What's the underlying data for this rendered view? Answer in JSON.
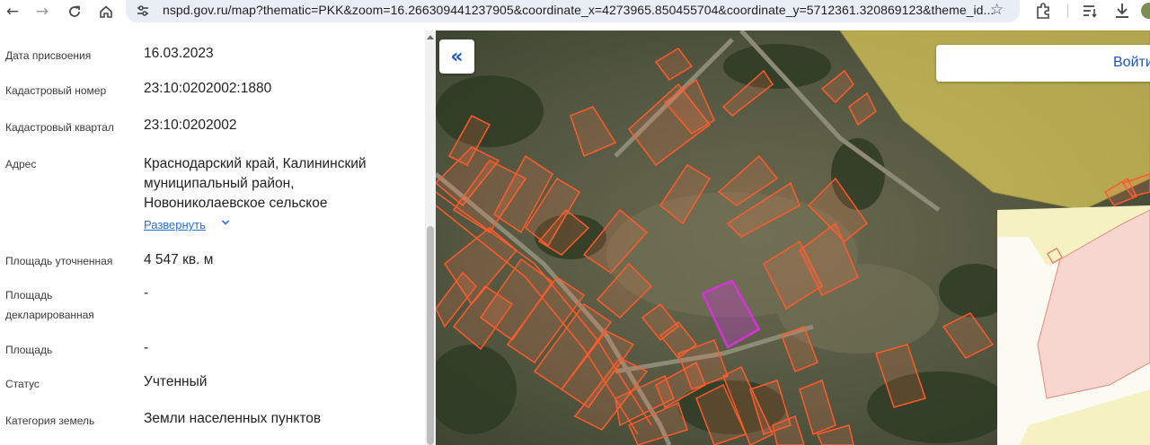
{
  "browser": {
    "url": "nspd.gov.ru/map?thematic=PKK&zoom=16.266309441237905&coordinate_x=4273965.850455704&coordinate_y=5712361.320869123&theme_id...",
    "icons": [
      "back-arrow-icon",
      "forward-arrow-icon",
      "reload-icon",
      "home-icon",
      "site-settings-icon",
      "bookmark-star-icon",
      "extensions-icon",
      "reading-list-icon",
      "download-icon"
    ]
  },
  "panel": {
    "rows": [
      {
        "label": "Дата присвоения",
        "value": "16.03.2023"
      },
      {
        "label": "Кадастровый номер",
        "value": "23:10:0202002:1880"
      },
      {
        "label": "Кадастровый квартал",
        "value": "23:10:0202002"
      },
      {
        "label": "Адрес",
        "value_lines": [
          "Краснодарский край, Калининский",
          "муниципальный район,",
          "Новониколаевское сельское"
        ],
        "expand_label": "Развернуть"
      },
      {
        "label": "Площадь уточненная",
        "value": "4 547 кв. м"
      },
      {
        "label_lines": [
          "Площадь",
          "декларированная"
        ],
        "value": "-"
      },
      {
        "label": "Площадь",
        "value": "-"
      },
      {
        "label": "Статус",
        "value": "Учтенный"
      },
      {
        "label": "Категория земель",
        "value": "Земли населенных пунктов"
      }
    ]
  },
  "map": {
    "collapse_icon": "double-chevron-left-icon",
    "login_label": "Войти",
    "colors": {
      "parcel_outline": "#ff5a2a",
      "selected_parcel": "#d433d6",
      "yellow_zone": "#d9c85a",
      "pink_zone": "#f7d6cf"
    }
  }
}
